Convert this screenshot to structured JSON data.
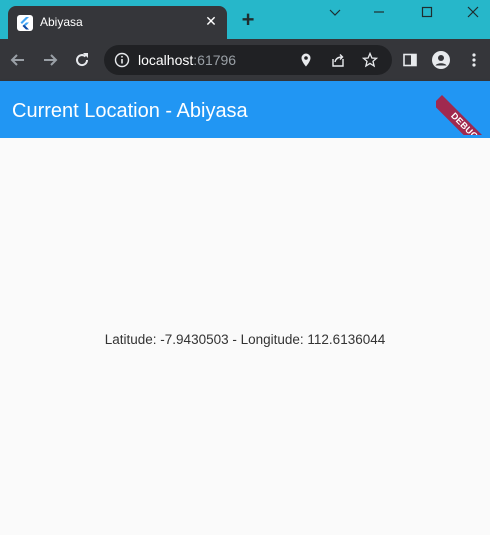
{
  "browser": {
    "tab": {
      "title": "Abiyasa",
      "close_symbol": "✕",
      "favicon": "flutter-icon"
    },
    "new_tab_symbol": "+",
    "window_controls": [
      "minimize-icon",
      "maximize-icon",
      "close-icon"
    ],
    "omnibox": {
      "host": "localhost",
      "port": ":61796"
    },
    "colors": {
      "tabstrip": "#26b7ca",
      "toolbar": "#35363a",
      "omnibox": "#202124"
    }
  },
  "app": {
    "title": "Current Location - Abiyasa",
    "debug_label": "DEBUG",
    "location_text": "Latitude: -7.9430503 - Longitude: 112.6136044",
    "colors": {
      "appbar": "#2196f3",
      "debug_banner": "#a0294f",
      "background": "#fafafa"
    }
  }
}
